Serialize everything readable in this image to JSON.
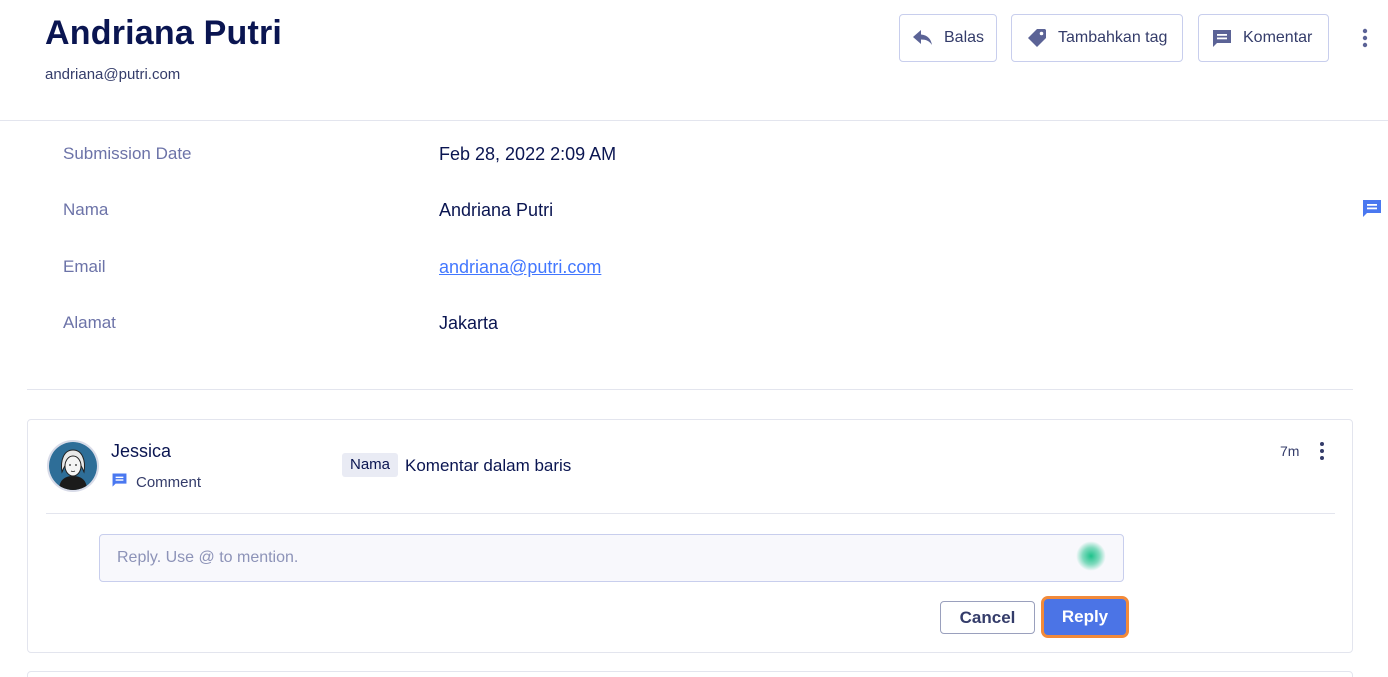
{
  "header": {
    "title": "Andriana Putri",
    "subtitle": "andriana@putri.com",
    "buttons": {
      "reply_label": "Balas",
      "tag_label": "Tambahkan tag",
      "comment_label": "Komentar"
    },
    "icons": [
      "reply-arrow-icon",
      "tag-icon",
      "comment-icon",
      "more-vertical-icon"
    ]
  },
  "fields": [
    {
      "label": "Submission Date",
      "value": "Feb 28, 2022 2:09 AM"
    },
    {
      "label": "Nama",
      "value": "Andriana Putri"
    },
    {
      "label": "Email",
      "value": "andriana@putri.com"
    },
    {
      "label": "Alamat",
      "value": "Jakarta"
    }
  ],
  "comment": {
    "author": "Jessica",
    "type_label": "Comment",
    "field_tag": "Nama",
    "text": "Komentar dalam baris",
    "time": "7m"
  },
  "reply": {
    "placeholder": "Reply. Use @ to mention.",
    "value": "",
    "cancel_label": "Cancel",
    "submit_label": "Reply"
  },
  "colors": {
    "navy": "#0a1551",
    "label_gray": "#6c73a8",
    "link_blue": "#4277ff",
    "primary_button": "#4b74e6",
    "focus_ring": "#f28a3a",
    "comment_icon_blue": "#4a78f0"
  }
}
